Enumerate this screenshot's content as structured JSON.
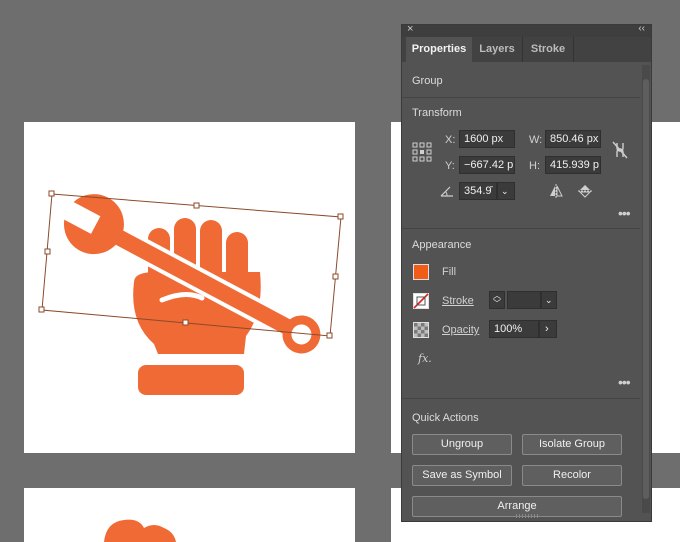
{
  "panel": {
    "tabs": [
      "Properties",
      "Layers",
      "Stroke"
    ],
    "selection_type": "Group",
    "transform": {
      "title": "Transform",
      "x_label": "X:",
      "x_value": "1600 px",
      "y_label": "Y:",
      "y_value": "−667.42 p",
      "w_label": "W:",
      "w_value": "850.46 px",
      "h_label": "H:",
      "h_value": "415.939 p",
      "angle_value": "354.9̄",
      "more": "•••"
    },
    "appearance": {
      "title": "Appearance",
      "fill_label": "Fill",
      "fill_color": "#f25c19",
      "stroke_label": "Stroke",
      "opacity_label": "Opacity",
      "opacity_value": "100%",
      "fx_label": "fx.",
      "more": "•••"
    },
    "quick_actions": {
      "title": "Quick Actions",
      "buttons": [
        "Ungroup",
        "Isolate Group",
        "Save as Symbol",
        "Recolor",
        "Arrange"
      ]
    }
  },
  "artwork": {
    "subject": "wrench in fist icon",
    "color": "#f06a35"
  }
}
